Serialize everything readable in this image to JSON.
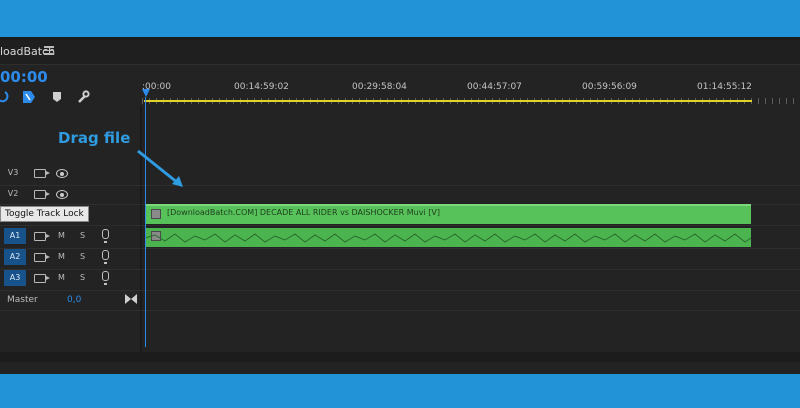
{
  "panel": {
    "title": "loadBatch",
    "timecode": "00:00"
  },
  "ruler": {
    "ticks": [
      ":00:00",
      "00:14:59:02",
      "00:29:58:04",
      "00:44:57:07",
      "00:59:56:09",
      "01:14:55:12"
    ]
  },
  "tracks": {
    "v3": {
      "name": "V3"
    },
    "v2": {
      "name": "V2"
    },
    "a1": {
      "name": "A1",
      "m": "M",
      "s": "S"
    },
    "a2": {
      "name": "A2",
      "m": "M",
      "s": "S"
    },
    "a3": {
      "name": "A3",
      "m": "M",
      "s": "S"
    },
    "master": {
      "label": "Master",
      "value": "0,0"
    }
  },
  "tooltip": "Toggle Track Lock",
  "clip": {
    "video_label": "[DownloadBatch.COM]  DECADE ALL RIDER vs DAISHOCKER Muvi [V]"
  },
  "annotation": "Drag file",
  "colors": {
    "accent": "#2d8ceb",
    "clip_green": "#58c25a",
    "workbar": "#e1d328",
    "page_bg": "#2193d6"
  }
}
